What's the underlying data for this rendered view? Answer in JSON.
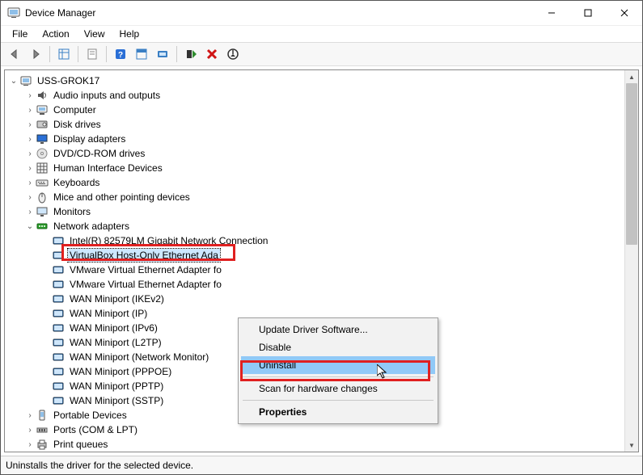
{
  "window": {
    "title": "Device Manager"
  },
  "menubar": [
    "File",
    "Action",
    "View",
    "Help"
  ],
  "root": {
    "label": "USS-GROK17"
  },
  "categories": [
    {
      "label": "Audio inputs and outputs",
      "icon": "audio"
    },
    {
      "label": "Computer",
      "icon": "computer"
    },
    {
      "label": "Disk drives",
      "icon": "disk"
    },
    {
      "label": "Display adapters",
      "icon": "display"
    },
    {
      "label": "DVD/CD-ROM drives",
      "icon": "dvd"
    },
    {
      "label": "Human Interface Devices",
      "icon": "hid"
    },
    {
      "label": "Keyboards",
      "icon": "keyboard"
    },
    {
      "label": "Mice and other pointing devices",
      "icon": "mouse"
    },
    {
      "label": "Monitors",
      "icon": "monitor"
    },
    {
      "label": "Network adapters",
      "icon": "network",
      "expanded": true,
      "children": [
        "Intel(R) 82579LM Gigabit Network Connection",
        "VirtualBox Host-Only Ethernet Ada",
        "VMware Virtual Ethernet Adapter fo",
        "VMware Virtual Ethernet Adapter fo",
        "WAN Miniport (IKEv2)",
        "WAN Miniport (IP)",
        "WAN Miniport (IPv6)",
        "WAN Miniport (L2TP)",
        "WAN Miniport (Network Monitor)",
        "WAN Miniport (PPPOE)",
        "WAN Miniport (PPTP)",
        "WAN Miniport (SSTP)"
      ],
      "selectedChild": 1
    },
    {
      "label": "Portable Devices",
      "icon": "portable"
    },
    {
      "label": "Ports (COM & LPT)",
      "icon": "ports"
    },
    {
      "label": "Print queues",
      "icon": "printer"
    }
  ],
  "context_menu": {
    "items": [
      {
        "label": "Update Driver Software..."
      },
      {
        "label": "Disable"
      },
      {
        "label": "Uninstall",
        "highlighted": true
      },
      {
        "separator": true
      },
      {
        "label": "Scan for hardware changes"
      },
      {
        "separator": true
      },
      {
        "label": "Properties",
        "bold": true
      }
    ]
  },
  "statusbar": {
    "text": "Uninstalls the driver for the selected device."
  },
  "colors": {
    "red_highlight": "#e02020",
    "selection_bg": "#91c9f7"
  }
}
